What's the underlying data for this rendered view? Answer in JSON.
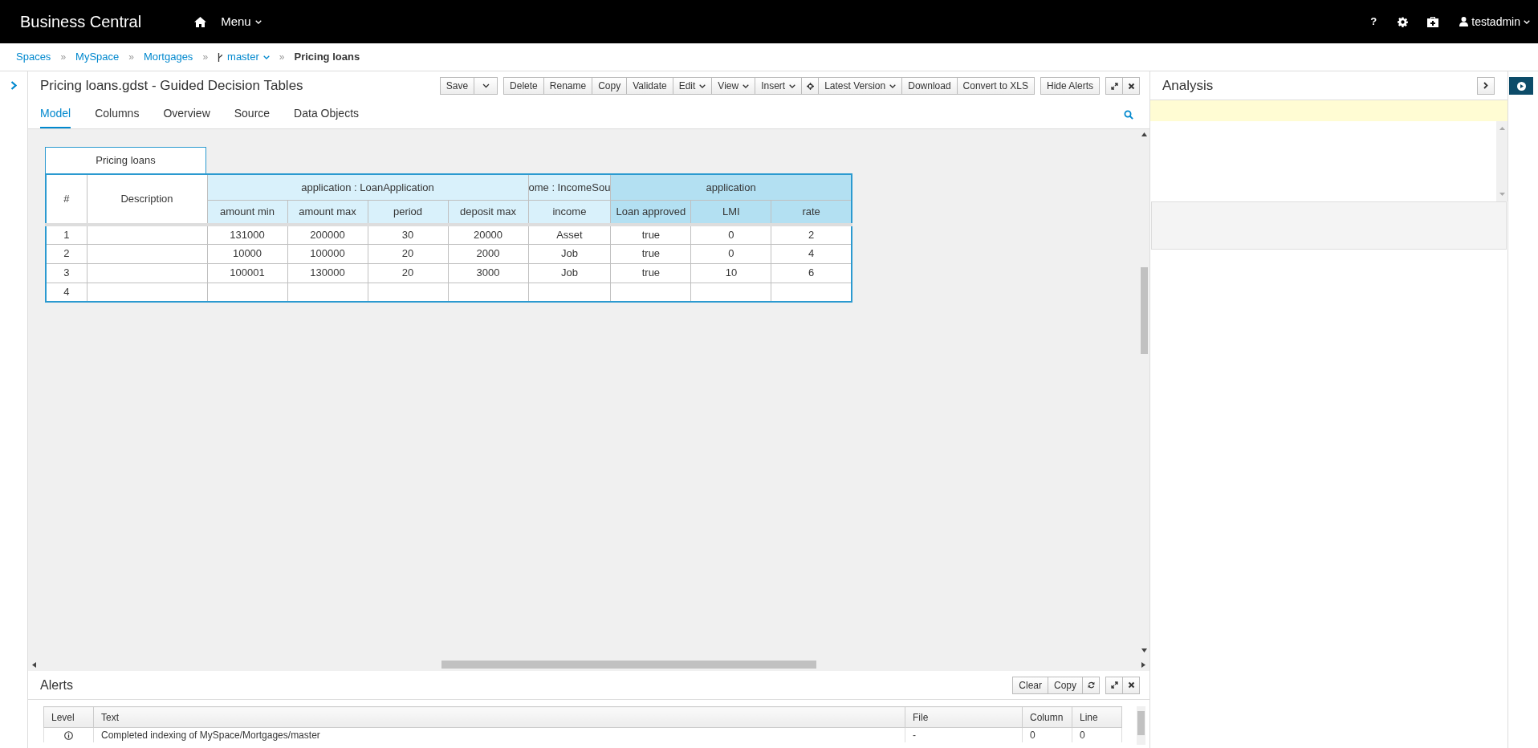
{
  "app": {
    "title": "Business Central",
    "menu": "Menu",
    "help": "?",
    "user": "testadmin"
  },
  "breadcrumbs": [
    {
      "label": "Spaces",
      "kind": "link"
    },
    {
      "label": "»",
      "kind": "separator"
    },
    {
      "label": "MySpace",
      "kind": "link"
    },
    {
      "label": "»",
      "kind": "separator"
    },
    {
      "label": "Mortgages",
      "kind": "link"
    },
    {
      "label": "»",
      "kind": "separator"
    },
    {
      "label": "master",
      "kind": "branch"
    },
    {
      "label": "»",
      "kind": "separator"
    },
    {
      "label": "Pricing loans",
      "kind": "current"
    }
  ],
  "editor": {
    "title": "Pricing loans.gdst - Guided Decision Tables",
    "toolbar": [
      [
        {
          "kind": "text",
          "label": "Save"
        },
        {
          "kind": "caret"
        }
      ],
      [
        {
          "kind": "text",
          "label": "Delete"
        },
        {
          "kind": "text",
          "label": "Rename"
        },
        {
          "kind": "text",
          "label": "Copy"
        },
        {
          "kind": "text",
          "label": "Validate"
        },
        {
          "kind": "text",
          "label": "Edit",
          "dropdown": true
        },
        {
          "kind": "text",
          "label": "View",
          "dropdown": true
        },
        {
          "kind": "text",
          "label": "Insert",
          "dropdown": true
        },
        {
          "kind": "locate"
        },
        {
          "kind": "text",
          "label": "Latest Version",
          "dropdown": true
        },
        {
          "kind": "text",
          "label": "Download"
        },
        {
          "kind": "text",
          "label": "Convert to XLS"
        }
      ],
      [
        {
          "kind": "text",
          "label": "Hide Alerts"
        }
      ],
      [
        {
          "kind": "maximize"
        },
        {
          "kind": "close"
        }
      ]
    ],
    "tabs": [
      {
        "label": "Model",
        "selected": true
      },
      {
        "label": "Columns",
        "selected": false
      },
      {
        "label": "Overview",
        "selected": false
      },
      {
        "label": "Source",
        "selected": false
      },
      {
        "label": "Data Objects",
        "selected": false
      }
    ]
  },
  "table": {
    "caption": "Pricing loans",
    "number_header": "#",
    "description_header": "Description",
    "groups": [
      {
        "label": "application : LoanApplication",
        "kind": "condition",
        "columns": [
          "amount min",
          "amount max",
          "period",
          "deposit max"
        ]
      },
      {
        "label": "ome : IncomeSou",
        "kind": "condition",
        "columns": [
          "income"
        ]
      },
      {
        "label": "application",
        "kind": "action",
        "columns": [
          "Loan approved",
          "LMI",
          "rate"
        ]
      }
    ],
    "rows": [
      {
        "number": "1",
        "cells": [
          "131000",
          "200000",
          "30",
          "20000",
          "Asset",
          "true",
          "0",
          "2"
        ]
      },
      {
        "number": "2",
        "cells": [
          "10000",
          "100000",
          "20",
          "2000",
          "Job",
          "true",
          "0",
          "4"
        ]
      },
      {
        "number": "3",
        "cells": [
          "100001",
          "130000",
          "20",
          "3000",
          "Job",
          "true",
          "10",
          "6"
        ]
      },
      {
        "number": "4"
      }
    ]
  },
  "analysis": {
    "title": "Analysis"
  },
  "alerts": {
    "title": "Alerts",
    "buttons": [
      {
        "kind": "text",
        "label": "Clear"
      },
      {
        "kind": "text",
        "label": "Copy"
      },
      {
        "kind": "refresh"
      }
    ],
    "window_buttons": [
      {
        "kind": "maximize"
      },
      {
        "kind": "close"
      }
    ],
    "columns": [
      "Level",
      "Text",
      "File",
      "Column",
      "Line"
    ],
    "rows": [
      {
        "kind": "info",
        "text": "Completed indexing of MySpace/Mortgages/master",
        "file": "-",
        "column": "0",
        "line": "0"
      }
    ]
  }
}
